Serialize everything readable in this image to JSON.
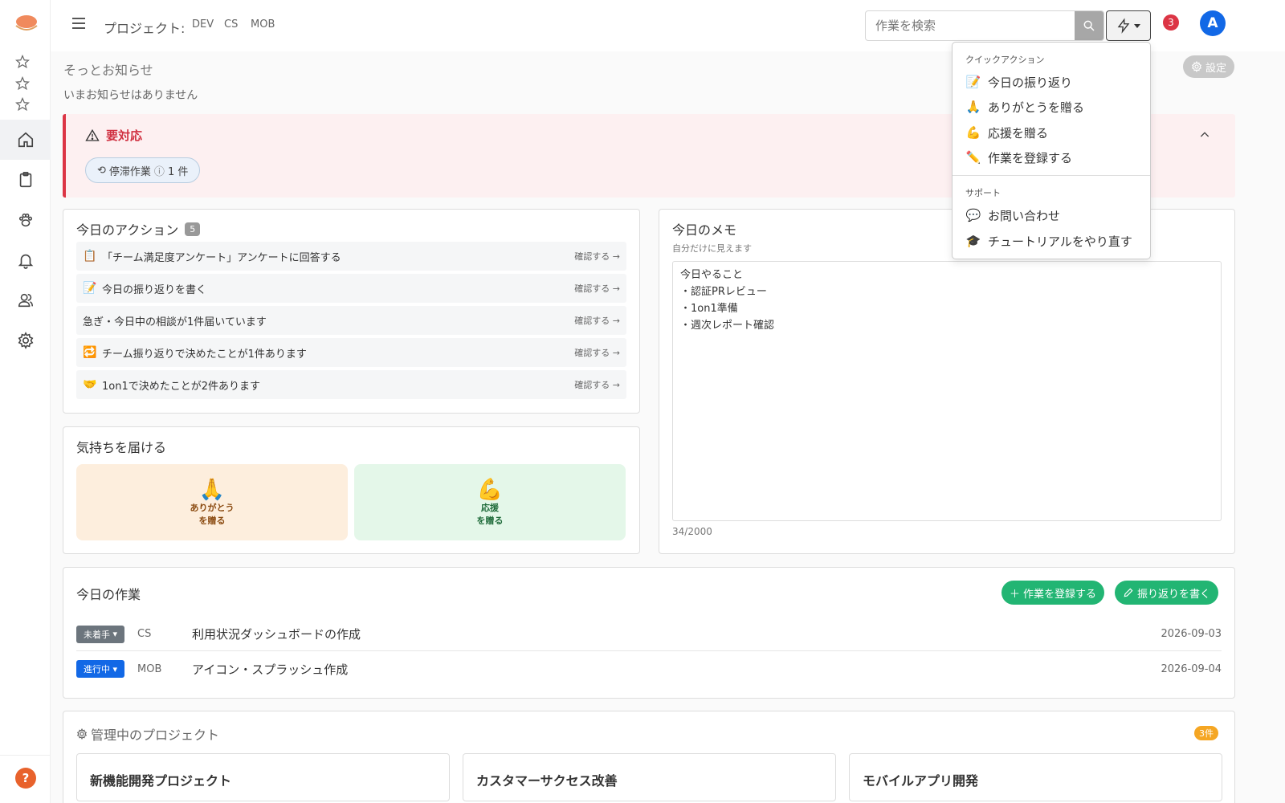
{
  "topbar": {
    "project_label": "プロジェクト:",
    "project_tags": [
      "DEV",
      "CS",
      "MOB"
    ],
    "search_placeholder": "作業を検索",
    "notification_count": "3",
    "avatar_letter": "A"
  },
  "notice": {
    "title": "そっとお知らせ",
    "empty": "いまお知らせはありません",
    "settings_label": "設定"
  },
  "alert": {
    "title": "要対応",
    "chip_label": "停滞作業",
    "chip_count": "1 件"
  },
  "actions": {
    "title": "今日のアクション",
    "count": "5",
    "confirm_label": "確認する →",
    "items": [
      {
        "emoji": "📋",
        "text": "「チーム満足度アンケート」アンケートに回答する"
      },
      {
        "emoji": "📝",
        "text": "今日の振り返りを書く"
      },
      {
        "emoji": "",
        "text": "急ぎ・今日中の相談が1件届いています"
      },
      {
        "emoji": "🔁",
        "text": "チーム振り返りで決めたことが1件あります"
      },
      {
        "emoji": "🤝",
        "text": "1on1で決めたことが2件あります"
      }
    ]
  },
  "feelings": {
    "title": "気持ちを届ける",
    "thanks": {
      "emoji": "🙏",
      "line1": "ありがとう",
      "line2": "を贈る"
    },
    "cheer": {
      "emoji": "💪",
      "line1": "応援",
      "line2": "を贈る"
    }
  },
  "memo": {
    "title": "今日のメモ",
    "subtitle": "自分だけに見えます",
    "content": "今日やること\n・認証PRレビュー\n・1on1準備\n・週次レポート確認",
    "counter": "34/2000"
  },
  "tasks": {
    "title": "今日の作業",
    "register_button": "作業を登録する",
    "reflect_button": "振り返りを書く",
    "rows": [
      {
        "status": "未着手",
        "project": "CS",
        "name": "利用状況ダッシュボードの作成",
        "date": "2026-09-03"
      },
      {
        "status": "進行中",
        "project": "MOB",
        "name": "アイコン・スプラッシュ作成",
        "date": "2026-09-04"
      }
    ]
  },
  "managed": {
    "title": "管理中のプロジェクト",
    "count": "3件",
    "projects": [
      "新機能開発プロジェクト",
      "カスタマーサクセス改善",
      "モバイルアプリ開発"
    ]
  },
  "dropdown": {
    "quick_header": "クイックアクション",
    "quick_items": [
      {
        "emoji": "📝",
        "label": "今日の振り返り"
      },
      {
        "emoji": "🙏",
        "label": "ありがとうを贈る"
      },
      {
        "emoji": "💪",
        "label": "応援を贈る"
      },
      {
        "emoji": "✏️",
        "label": "作業を登録する"
      }
    ],
    "support_header": "サポート",
    "support_items": [
      {
        "emoji": "💬",
        "label": "お問い合わせ"
      },
      {
        "emoji": "🎓",
        "label": "チュートリアルをやり直す"
      }
    ]
  },
  "help_label": "?",
  "colors": {
    "alert_red": "#dc3545",
    "success_green": "#22b573",
    "primary_blue": "#1268e6",
    "todo_gray": "#6c757d",
    "badge_orange": "#f5a623"
  }
}
